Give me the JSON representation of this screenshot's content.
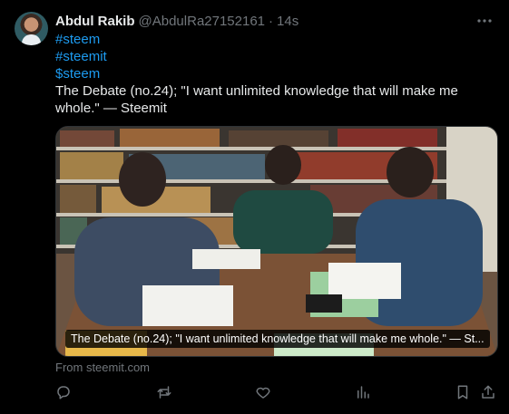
{
  "tweet": {
    "author_name": "Abdul Rakib",
    "handle": "@AbdulRa27152161",
    "separator": "·",
    "time": "14s",
    "hashtags": [
      "#steem",
      "#steemit",
      "$steem"
    ],
    "text": "The Debate (no.24); \"I want unlimited knowledge that will make me whole.\" — Steemit",
    "card_caption": "The Debate (no.24); \"I want unlimited knowledge that will make me whole.\" — St...",
    "card_source": "From steemit.com"
  },
  "icons": {
    "more": "more-icon",
    "reply": "reply-icon",
    "retweet": "retweet-icon",
    "like": "like-icon",
    "views": "views-icon",
    "bookmark": "bookmark-icon",
    "share": "share-icon"
  },
  "colors": {
    "background": "#000000",
    "text": "#e7e9ea",
    "muted": "#71767b",
    "link": "#1d9bf0"
  }
}
